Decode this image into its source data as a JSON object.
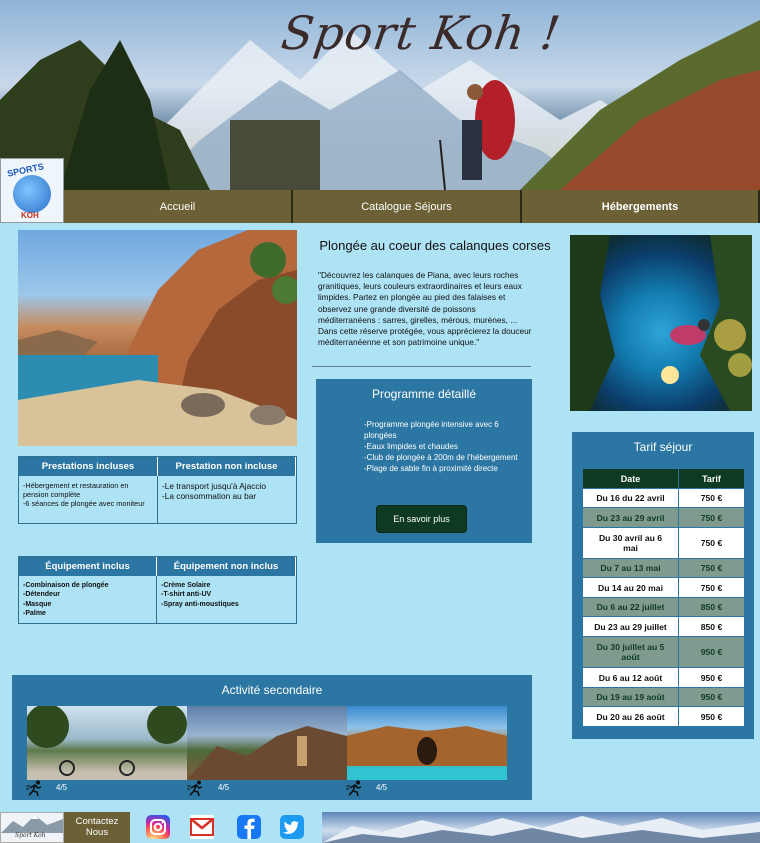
{
  "header": {
    "title": "Sport Koh !"
  },
  "logo": {
    "top_text": "SPORTS",
    "bottom_text": "KOH"
  },
  "nav": {
    "items": [
      {
        "label": "Accueil"
      },
      {
        "label": "Catalogue Séjours"
      },
      {
        "label": "Hébergements"
      }
    ]
  },
  "intro": {
    "title": "Plongée au coeur des calanques corses",
    "text": "\"Découvrez les calanques de Piana, avec leurs roches granitiques, leurs couleurs extraordinaires et leurs eaux limpides. Partez en plongée au pied des falaises et observez une grande diversité de poissons méditerranéens : sarres, girelles, mérous, murènes, ... Dans cette réserve protégée, vous apprécierez la douceur méditerranéenne et son patrimoine unique.\""
  },
  "prestations": {
    "included_header": "Prestations incluses",
    "excluded_header": "Prestation non incluse",
    "included": "-Hébergement et restauration en pension complète\n-6 séances de plongée avec moniteur",
    "excluded": "-Le transport jusqu'à Ajaccio\n-La consommation au bar"
  },
  "equipement": {
    "included_header": "Équipement inclus",
    "excluded_header": "Équipement non inclus",
    "included": "-Combinaison de plongée\n-Détendeur\n-Masque\n-Palme",
    "excluded": "-Crème Solaire\n-T-shirt anti-UV\n-Spray anti-moustiques"
  },
  "programme": {
    "title": "Programme détaillé",
    "items": "-Programme plongée intensive avec 6 plongées\n-Eaux limpides et chaudes\n-Club de plongée à 200m de l'hébergement\n-Plage de sable fin à proximité directe",
    "button": "En savoir plus"
  },
  "tarif": {
    "title": "Tarif séjour",
    "col_date": "Date",
    "col_price": "Tarif",
    "rows": [
      {
        "date": "Du 16 du 22 avril",
        "price": "750 €"
      },
      {
        "date": "Du 23 au 29 avril",
        "price": "750 €"
      },
      {
        "date": "Du 30 avril au 6 mai",
        "price": "750 €"
      },
      {
        "date": "Du 7 au 13 mai",
        "price": "750 €"
      },
      {
        "date": "Du 14 au 20 mai",
        "price": "750 €"
      },
      {
        "date": "Du 6 au 22 juillet",
        "price": "850 €"
      },
      {
        "date": "Du 23 au 29 juillet",
        "price": "850 €"
      },
      {
        "date": "Du 30 juillet au 5 août",
        "price": "950 €"
      },
      {
        "date": "Du 6 au 12 août",
        "price": "950 €"
      },
      {
        "date": "Du 19 au 19 août",
        "price": "950 €"
      },
      {
        "date": "Du 20 au 26 août",
        "price": "950 €"
      }
    ]
  },
  "activite": {
    "title": "Activité secondaire",
    "cards": [
      {
        "rating": "4/5",
        "icon": "running-icon"
      },
      {
        "rating": "4/5",
        "icon": "running-icon"
      },
      {
        "rating": "4/5",
        "icon": "running-icon"
      }
    ]
  },
  "footer": {
    "logo_text": "Sport Koh",
    "contact": "Contactez Nous",
    "socials": [
      "instagram-icon",
      "gmail-icon",
      "facebook-icon",
      "twitter-icon"
    ]
  }
}
